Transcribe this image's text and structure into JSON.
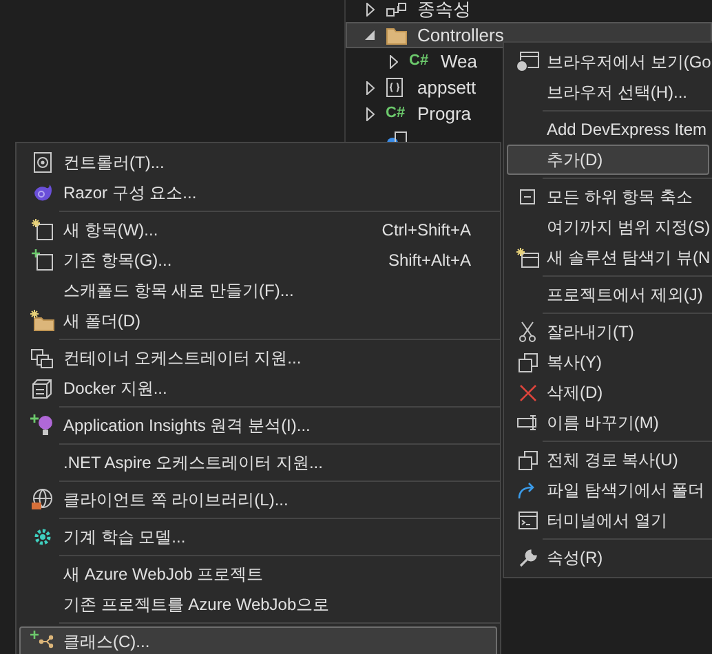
{
  "tree": {
    "items": [
      {
        "label": "종속성",
        "kind": "dependencies",
        "expanded": false,
        "selected": false
      },
      {
        "label": "Controllers",
        "kind": "folder",
        "expanded": true,
        "selected": true,
        "children": [
          {
            "label": "Wea",
            "kind": "csharp",
            "icon_text": "C#",
            "expanded": false,
            "selected": false
          }
        ]
      },
      {
        "label": "appsett",
        "kind": "json",
        "expanded": false,
        "selected": false
      },
      {
        "label": "Progra",
        "kind": "csharp",
        "icon_text": "C#",
        "expanded": false,
        "selected": false
      },
      {
        "kind": "service",
        "selected": false
      }
    ]
  },
  "context_menu": {
    "items": [
      {
        "kind": "browser",
        "label": "브라우저에서 보기(Go",
        "selected": false
      },
      {
        "kind": "plain",
        "label": "브라우저 선택(H)...",
        "selected": false
      },
      {
        "kind": "separator"
      },
      {
        "kind": "plain",
        "label": "Add DevExpress Item",
        "selected": false
      },
      {
        "kind": "plain",
        "label": "추가(D)",
        "selected": true
      },
      {
        "kind": "separator"
      },
      {
        "kind": "collapse",
        "label": "모든 하위 항목 축소",
        "selected": false
      },
      {
        "kind": "plain",
        "label": "여기까지 범위 지정(S)",
        "selected": false
      },
      {
        "kind": "new-window",
        "label": "새 솔루션 탐색기 뷰(N",
        "selected": false
      },
      {
        "kind": "separator"
      },
      {
        "kind": "plain",
        "label": "프로젝트에서 제외(J)",
        "selected": false
      },
      {
        "kind": "separator"
      },
      {
        "kind": "cut",
        "label": "잘라내기(T)",
        "selected": false
      },
      {
        "kind": "copy",
        "label": "복사(Y)",
        "selected": false
      },
      {
        "kind": "delete",
        "label": "삭제(D)",
        "selected": false
      },
      {
        "kind": "rename",
        "label": "이름 바꾸기(M)",
        "selected": false
      },
      {
        "kind": "separator"
      },
      {
        "kind": "copy",
        "label": "전체 경로 복사(U)",
        "selected": false
      },
      {
        "kind": "redo",
        "label": "파일 탐색기에서 폴더",
        "selected": false
      },
      {
        "kind": "terminal",
        "label": "터미널에서 열기",
        "selected": false
      },
      {
        "kind": "separator"
      },
      {
        "kind": "wrench",
        "label": "속성(R)",
        "selected": false
      }
    ]
  },
  "add_submenu": {
    "items": [
      {
        "kind": "controller",
        "label": "컨트롤러(T)...",
        "selected": false
      },
      {
        "kind": "razor",
        "label": "Razor 구성 요소...",
        "selected": false
      },
      {
        "kind": "separator"
      },
      {
        "kind": "new-item",
        "label": "새 항목(W)...",
        "shortcut": "Ctrl+Shift+A",
        "selected": false
      },
      {
        "kind": "existing-item",
        "label": "기존 항목(G)...",
        "shortcut": "Shift+Alt+A",
        "selected": false
      },
      {
        "kind": "plain",
        "label": "스캐폴드 항목 새로 만들기(F)...",
        "selected": false
      },
      {
        "kind": "new-folder",
        "label": "새 폴더(D)",
        "selected": false
      },
      {
        "kind": "separator"
      },
      {
        "kind": "containers",
        "label": "컨테이너 오케스트레이터 지원...",
        "selected": false
      },
      {
        "kind": "container",
        "label": "Docker 지원...",
        "selected": false
      },
      {
        "kind": "separator"
      },
      {
        "kind": "insights",
        "label": "Application Insights 원격 분석(I)...",
        "selected": false
      },
      {
        "kind": "separator"
      },
      {
        "kind": "plain",
        "label": ".NET Aspire 오케스트레이터 지원...",
        "selected": false
      },
      {
        "kind": "separator"
      },
      {
        "kind": "globe",
        "label": "클라이언트 쪽 라이브러리(L)...",
        "selected": false
      },
      {
        "kind": "separator"
      },
      {
        "kind": "gear",
        "label": "기계 학습 모델...",
        "selected": false
      },
      {
        "kind": "separator"
      },
      {
        "kind": "plain",
        "label": "새 Azure WebJob 프로젝트",
        "selected": false
      },
      {
        "kind": "plain",
        "label": "기존 프로젝트를 Azure WebJob으로",
        "selected": false
      },
      {
        "kind": "separator"
      },
      {
        "kind": "class",
        "label": "클래스(C)...",
        "selected": true
      }
    ]
  }
}
